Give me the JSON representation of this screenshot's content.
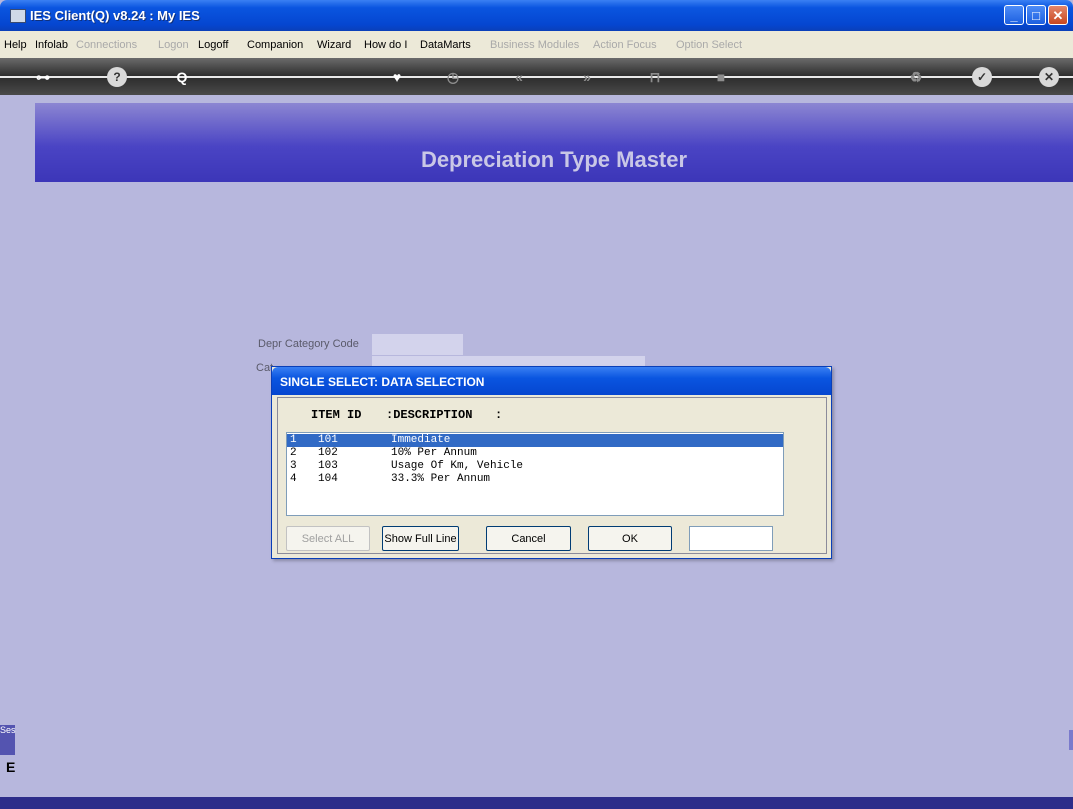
{
  "window": {
    "title": "IES Client(Q) v8.24 : My IES"
  },
  "menu": [
    {
      "label": "Help",
      "enabled": true
    },
    {
      "label": "Infolab",
      "enabled": true
    },
    {
      "label": "Connections",
      "enabled": false
    },
    {
      "label": "Logon",
      "enabled": false
    },
    {
      "label": "Logoff",
      "enabled": true
    },
    {
      "label": "Companion",
      "enabled": true
    },
    {
      "label": "Wizard",
      "enabled": true
    },
    {
      "label": "How do I",
      "enabled": true
    },
    {
      "label": "DataMarts",
      "enabled": true
    },
    {
      "label": "Business Modules",
      "enabled": false
    },
    {
      "label": "Action Focus",
      "enabled": false
    },
    {
      "label": "Option Select",
      "enabled": false
    }
  ],
  "toolbar": {
    "icons": [
      "key-icon",
      "help-icon",
      "search-icon",
      "heart-icon",
      "clock-icon",
      "back-icon",
      "forward-icon",
      "trash-icon",
      "stop-icon",
      "recycle-icon",
      "check-icon",
      "cancel-icon"
    ]
  },
  "header": {
    "title": "Depreciation Type Master"
  },
  "form": {
    "depr_category_code_label": "Depr Category Code",
    "category_label_partial": "Cat"
  },
  "dialog": {
    "title": "SINGLE SELECT: DATA SELECTION",
    "col_item_id": "ITEM ID",
    "col_description": ":DESCRIPTION",
    "col_extra": ":",
    "rows": [
      {
        "n": "1",
        "id": "101",
        "desc": "Immediate",
        "selected": true
      },
      {
        "n": "2",
        "id": "102",
        "desc": "10% Per Annum",
        "selected": false
      },
      {
        "n": "3",
        "id": "103",
        "desc": "Usage Of Km, Vehicle",
        "selected": false
      },
      {
        "n": "4",
        "id": "104",
        "desc": "33.3% Per Annum",
        "selected": false
      }
    ],
    "buttons": {
      "select_all": "Select ALL",
      "show_full_line": "Show Full Line",
      "cancel": "Cancel",
      "ok": "OK"
    }
  },
  "session": {
    "tab_label": "Ses",
    "value": "E"
  },
  "colors": {
    "header_top": "#8c86d2",
    "header_bottom": "#3c36b8",
    "background": "#b7b7dd",
    "selection": "#316ac5"
  }
}
